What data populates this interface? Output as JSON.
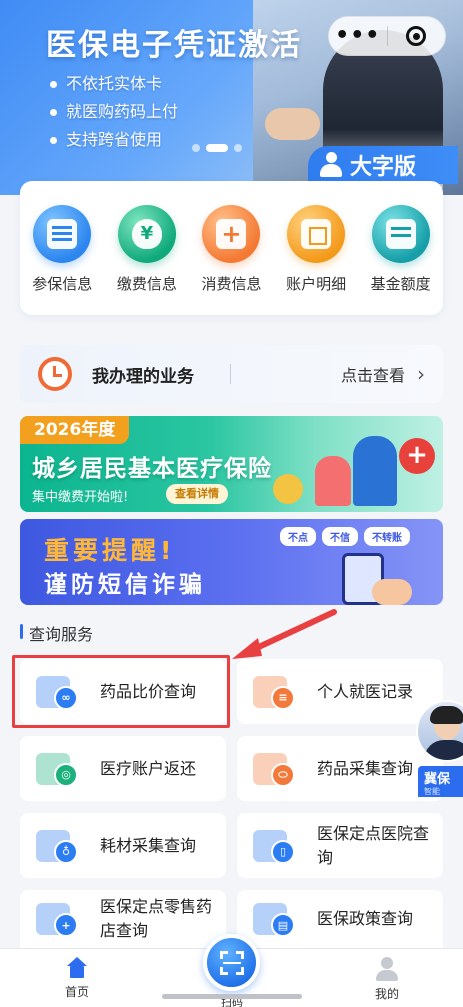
{
  "banner": {
    "title": "医保电子凭证激活",
    "bullets": [
      "不依托实体卡",
      "就医购药码上付",
      "支持跨省使用"
    ],
    "big_font_label": "大字版"
  },
  "capsule": {
    "more": "•••"
  },
  "quick_menu": [
    {
      "label": "参保信息",
      "color": "blue"
    },
    {
      "label": "缴费信息",
      "color": "green"
    },
    {
      "label": "消费信息",
      "color": "orange"
    },
    {
      "label": "账户明细",
      "color": "amber"
    },
    {
      "label": "基金额度",
      "color": "teal"
    }
  ],
  "business": {
    "title": "我办理的业务",
    "link": "点击查看",
    "arrow": "›"
  },
  "ad_insurance": {
    "tag": "2026年度",
    "title": "城乡居民基本医疗保险",
    "subtitle": "集中缴费开始啦!",
    "button": "查看详情"
  },
  "ad_fraud": {
    "line1": "重要提醒!",
    "line2": "谨防短信诈骗",
    "tags": [
      "不点",
      "不信",
      "不转账"
    ]
  },
  "section": {
    "title": "查询服务"
  },
  "services": [
    {
      "label": "药品比价查询",
      "color": "blue"
    },
    {
      "label": "个人就医记录",
      "color": "orange"
    },
    {
      "label": "医疗账户返还",
      "color": "green"
    },
    {
      "label": "药品采集查询",
      "color": "orange"
    },
    {
      "label": "耗材采集查询",
      "color": "blue"
    },
    {
      "label": "医保定点医院查询",
      "color": "blue"
    },
    {
      "label": "医保定点零售药店查询",
      "color": "blue"
    },
    {
      "label": "医保政策查询",
      "color": "blue"
    }
  ],
  "assistant": {
    "name": "冀保",
    "sub": "智能"
  },
  "tabbar": {
    "home": "首页",
    "scan": "扫码",
    "me": "我的"
  },
  "colors": {
    "primary": "#2c6df0",
    "highlight": "#e84040"
  }
}
